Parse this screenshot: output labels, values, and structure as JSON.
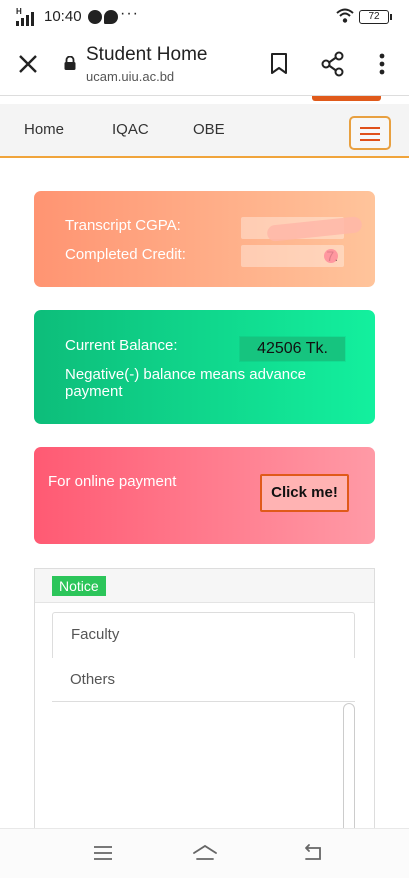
{
  "status_bar": {
    "network": "H",
    "time": "10:40",
    "notification_dots": "···",
    "battery": "72"
  },
  "browser": {
    "title": "Student Home",
    "url": "ucam.uiu.ac.bd"
  },
  "nav": {
    "items": [
      "Home",
      "IQAC",
      "OBE"
    ]
  },
  "cgpa_card": {
    "cgpa_label": "Transcript CGPA:",
    "cgpa_value": "",
    "credit_label": "Completed Credit:",
    "credit_value": "7."
  },
  "balance_card": {
    "label": "Current Balance:",
    "value": "42506 Tk.",
    "note": "Negative(-) balance means advance payment"
  },
  "payment_card": {
    "label": "For online payment",
    "button": "Click me!"
  },
  "notice": {
    "badge": "Notice",
    "tabs": [
      "Faculty",
      "Others"
    ]
  },
  "colors": {
    "accent_orange": "#e05a1a",
    "nav_underline": "#f0a43b",
    "cgpa_gradient": [
      "#ff9472",
      "#ffc49b"
    ],
    "balance_gradient": [
      "#0dbd7a",
      "#13f09e"
    ],
    "payment_gradient": [
      "#ff5a73",
      "#ff9aa6"
    ],
    "notice_badge": "#2cc55a"
  },
  "icons": {
    "browser": [
      "close-icon",
      "lock-icon",
      "bookmark-icon",
      "share-icon",
      "more-vert-icon",
      "menu-icon"
    ],
    "system_nav": [
      "recents-icon",
      "home-icon",
      "back-icon"
    ]
  }
}
